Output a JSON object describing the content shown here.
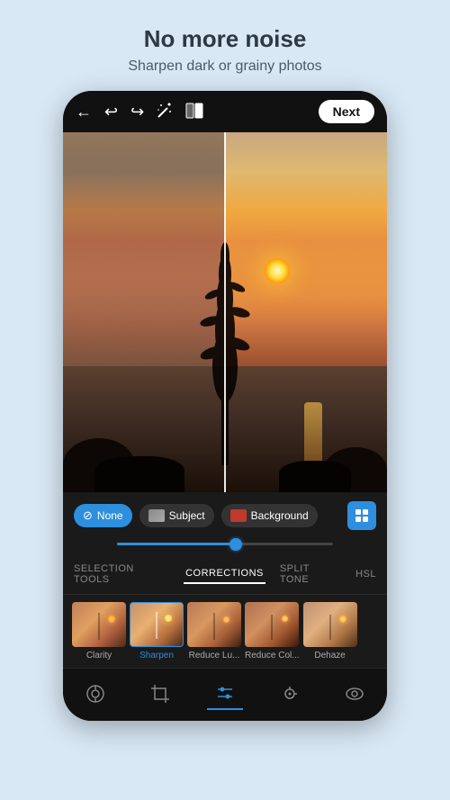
{
  "header": {
    "title": "No more noise",
    "subtitle": "Sharpen dark or grainy photos"
  },
  "topbar": {
    "back_icon": "←",
    "undo_icon": "↩",
    "redo_icon": "↪",
    "wand_icon": "✦",
    "compare_icon": "⬛",
    "next_label": "Next"
  },
  "selection": {
    "none_label": "None",
    "subject_label": "Subject",
    "background_label": "Background",
    "stack_icon": "⊞"
  },
  "tabs": [
    {
      "id": "selection-tools",
      "label": "SELECTION TOOLS",
      "active": false
    },
    {
      "id": "corrections",
      "label": "CORRECTIONS",
      "active": true
    },
    {
      "id": "split-tone",
      "label": "SPLIT TONE",
      "active": false
    },
    {
      "id": "hsl",
      "label": "HSL",
      "active": false
    }
  ],
  "tools": [
    {
      "id": "clarity",
      "label": "Clarity",
      "active": false
    },
    {
      "id": "sharpen",
      "label": "Sharpen",
      "active": true
    },
    {
      "id": "reduce-lu",
      "label": "Reduce Lu...",
      "active": false
    },
    {
      "id": "reduce-col",
      "label": "Reduce Col...",
      "active": false
    },
    {
      "id": "dehaze",
      "label": "Dehaze",
      "active": false
    }
  ],
  "bottom_nav": [
    {
      "id": "presets",
      "icon": "◎",
      "active": false
    },
    {
      "id": "crop",
      "icon": "⊡",
      "active": false
    },
    {
      "id": "adjustments",
      "icon": "⚙",
      "active": true
    },
    {
      "id": "healing",
      "icon": "✦",
      "active": false
    },
    {
      "id": "view",
      "icon": "👁",
      "active": false
    }
  ],
  "colors": {
    "accent": "#2d8fdd",
    "bg": "#d8e8f5",
    "none_chip_bg": "#2d8fdd",
    "subject_chip_bg": "#333333",
    "background_chip_bg": "#333333",
    "active_tab": "#ffffff",
    "active_tool_label": "#2d8fdd"
  }
}
